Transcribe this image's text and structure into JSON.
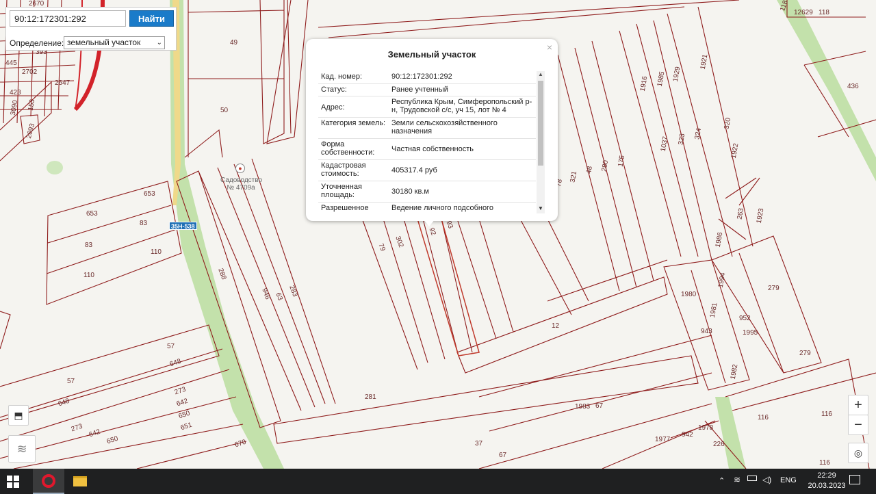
{
  "search": {
    "value": "90:12:172301:292",
    "button_label": "Найти",
    "type_label": "Определение:",
    "type_value": "земельный участок"
  },
  "popup": {
    "title": "Земельный участок",
    "rows": [
      {
        "key": "Кад. номер:",
        "value": "90:12:172301:292"
      },
      {
        "key": "Статус:",
        "value": "Ранее учтенный"
      },
      {
        "key": "Адрес:",
        "value": "Республика Крым, Симферопольский р-н, Трудовской с/с, уч 15, лот № 4"
      },
      {
        "key": "Категория земель:",
        "value": "Земли сельскохозяйственного назначения"
      },
      {
        "key": "Форма собственности:",
        "value": "Частная собственность"
      },
      {
        "key": "Кадастровая стоимость:",
        "value": "405317.4 руб"
      },
      {
        "key": "Уточненная площадь:",
        "value": "30180 кв.м"
      },
      {
        "key": "Разрешенное",
        "value": "Ведение личного подсобного"
      }
    ]
  },
  "map": {
    "poi_label": "Садоводство № 4709а",
    "road_label": "35Н-538",
    "parcel_labels": [
      "49",
      "50",
      "653",
      "653",
      "83",
      "83",
      "110",
      "110",
      "57",
      "648",
      "57",
      "648",
      "273",
      "642",
      "273",
      "642",
      "650",
      "651",
      "650",
      "670",
      "288",
      "946",
      "63",
      "283",
      "79",
      "302",
      "92",
      "93",
      "12",
      "281",
      "1983",
      "67",
      "37",
      "67",
      "1977",
      "942",
      "1978",
      "226",
      "116",
      "116",
      "116",
      "1980",
      "1981",
      "943",
      "1994",
      "952",
      "1995",
      "279",
      "279",
      "1982",
      "1916",
      "1985",
      "1929",
      "1037",
      "323",
      "324",
      "1921",
      "320",
      "1922",
      "263",
      "1923",
      "1986",
      "321",
      "48",
      "280",
      "175",
      "78",
      "12629",
      "118",
      "118",
      "436",
      "2724",
      "2702",
      "2647",
      "393",
      "445",
      "2670",
      "423",
      "3090",
      "153",
      "2693"
    ]
  },
  "taskbar": {
    "time": "22:29",
    "date": "20.03.2023",
    "lang": "ENG"
  },
  "colors": {
    "parcel_line": "#8e1b1b",
    "road_green": "#b9dca0",
    "road_yellow": "#f1df8c",
    "button_blue": "#1a7bc9"
  }
}
